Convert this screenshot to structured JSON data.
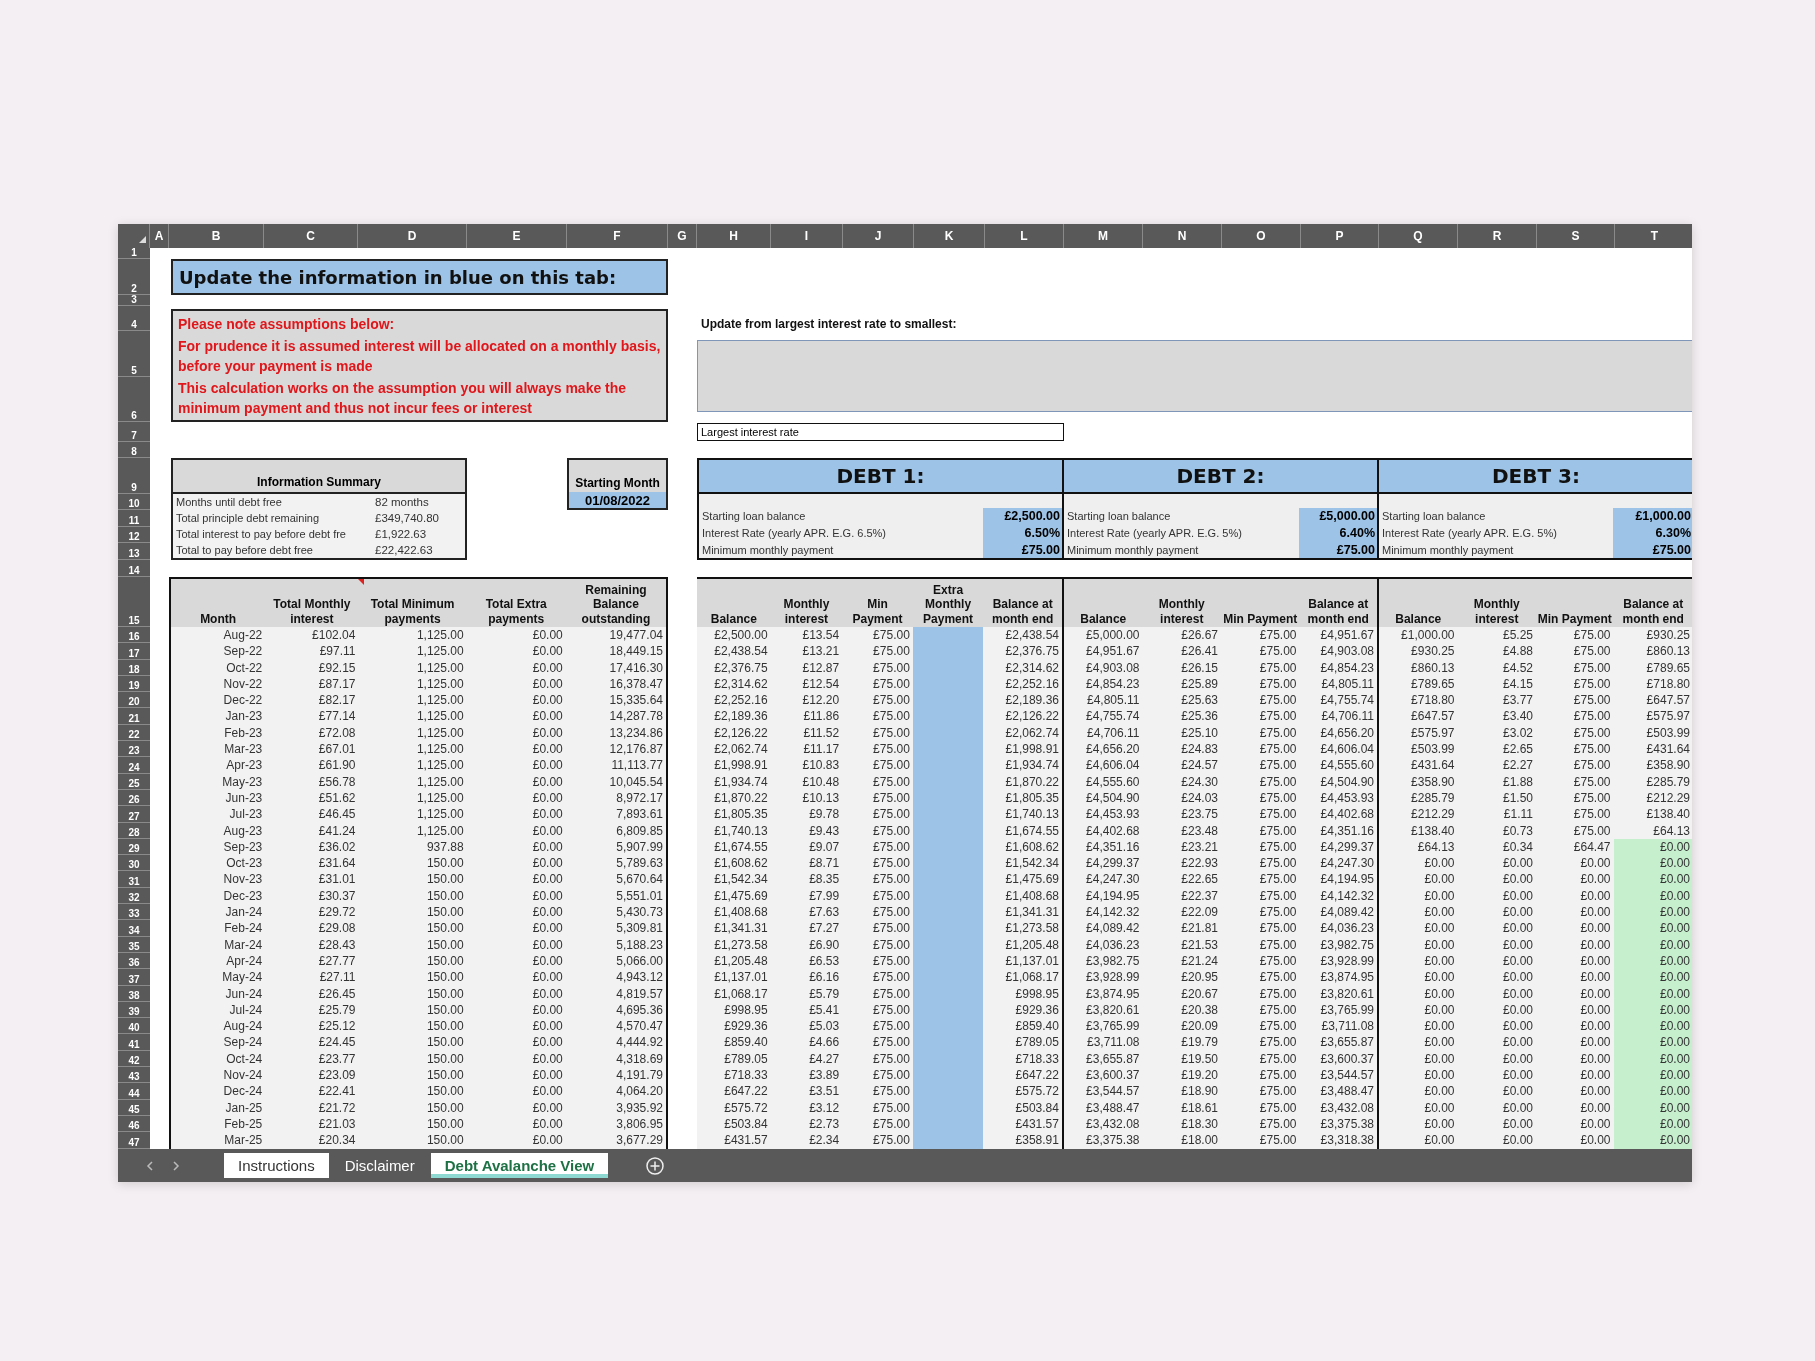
{
  "column_letters": [
    "A",
    "B",
    "C",
    "D",
    "E",
    "F",
    "G",
    "H",
    "I",
    "J",
    "K",
    "L",
    "M",
    "N",
    "O",
    "P",
    "Q",
    "R",
    "S",
    "T"
  ],
  "row_numbers": [
    "1",
    "2",
    "3",
    "4",
    "5",
    "6",
    "7",
    "8",
    "9",
    "10",
    "11",
    "12",
    "13",
    "14",
    "15",
    "16",
    "17",
    "18",
    "19",
    "20",
    "21",
    "22",
    "23",
    "24",
    "25",
    "26",
    "27",
    "28",
    "29",
    "30",
    "31",
    "32",
    "33",
    "34",
    "35",
    "36",
    "37",
    "38",
    "39",
    "40",
    "41",
    "42",
    "43",
    "44",
    "45",
    "46",
    "47"
  ],
  "title": "Update the information in blue on this tab:",
  "assumptions": {
    "heading": "Please note assumptions below:",
    "notes": [
      "For prudence it is assumed interest will be allocated on a monthly basis, before your payment is made",
      "This calculation works on the assumption you will always make the minimum payment and thus not incur fees or interest"
    ]
  },
  "summary": {
    "title": "Information Summary",
    "items": [
      {
        "label": "Months until debt free",
        "value": "82 months"
      },
      {
        "label": "Total principle debt remaining",
        "value": "£349,740.80"
      },
      {
        "label": "Total interest to pay before debt fre",
        "value": "£1,922.63"
      },
      {
        "label": "Total to pay before debt free",
        "value": "£22,422.63"
      }
    ]
  },
  "starting_month": {
    "label": "Starting Month",
    "value": "01/08/2022"
  },
  "debt_order": {
    "instruction": "Update from largest interest rate to smallest:",
    "first_slot": "Largest interest rate"
  },
  "schedule": {
    "columns": [
      "Month",
      "Total Monthly interest",
      "Total Minimum payments",
      "Total Extra payments",
      "Remaining Balance outstanding"
    ],
    "rows": [
      [
        "Aug-22",
        "£102.04",
        "1,125.00",
        "£0.00",
        "19,477.04"
      ],
      [
        "Sep-22",
        "£97.11",
        "1,125.00",
        "£0.00",
        "18,449.15"
      ],
      [
        "Oct-22",
        "£92.15",
        "1,125.00",
        "£0.00",
        "17,416.30"
      ],
      [
        "Nov-22",
        "£87.17",
        "1,125.00",
        "£0.00",
        "16,378.47"
      ],
      [
        "Dec-22",
        "£82.17",
        "1,125.00",
        "£0.00",
        "15,335.64"
      ],
      [
        "Jan-23",
        "£77.14",
        "1,125.00",
        "£0.00",
        "14,287.78"
      ],
      [
        "Feb-23",
        "£72.08",
        "1,125.00",
        "£0.00",
        "13,234.86"
      ],
      [
        "Mar-23",
        "£67.01",
        "1,125.00",
        "£0.00",
        "12,176.87"
      ],
      [
        "Apr-23",
        "£61.90",
        "1,125.00",
        "£0.00",
        "11,113.77"
      ],
      [
        "May-23",
        "£56.78",
        "1,125.00",
        "£0.00",
        "10,045.54"
      ],
      [
        "Jun-23",
        "£51.62",
        "1,125.00",
        "£0.00",
        "8,972.17"
      ],
      [
        "Jul-23",
        "£46.45",
        "1,125.00",
        "£0.00",
        "7,893.61"
      ],
      [
        "Aug-23",
        "£41.24",
        "1,125.00",
        "£0.00",
        "6,809.85"
      ],
      [
        "Sep-23",
        "£36.02",
        "937.88",
        "£0.00",
        "5,907.99"
      ],
      [
        "Oct-23",
        "£31.64",
        "150.00",
        "£0.00",
        "5,789.63"
      ],
      [
        "Nov-23",
        "£31.01",
        "150.00",
        "£0.00",
        "5,670.64"
      ],
      [
        "Dec-23",
        "£30.37",
        "150.00",
        "£0.00",
        "5,551.01"
      ],
      [
        "Jan-24",
        "£29.72",
        "150.00",
        "£0.00",
        "5,430.73"
      ],
      [
        "Feb-24",
        "£29.08",
        "150.00",
        "£0.00",
        "5,309.81"
      ],
      [
        "Mar-24",
        "£28.43",
        "150.00",
        "£0.00",
        "5,188.23"
      ],
      [
        "Apr-24",
        "£27.77",
        "150.00",
        "£0.00",
        "5,066.00"
      ],
      [
        "May-24",
        "£27.11",
        "150.00",
        "£0.00",
        "4,943.12"
      ],
      [
        "Jun-24",
        "£26.45",
        "150.00",
        "£0.00",
        "4,819.57"
      ],
      [
        "Jul-24",
        "£25.79",
        "150.00",
        "£0.00",
        "4,695.36"
      ],
      [
        "Aug-24",
        "£25.12",
        "150.00",
        "£0.00",
        "4,570.47"
      ],
      [
        "Sep-24",
        "£24.45",
        "150.00",
        "£0.00",
        "4,444.92"
      ],
      [
        "Oct-24",
        "£23.77",
        "150.00",
        "£0.00",
        "4,318.69"
      ],
      [
        "Nov-24",
        "£23.09",
        "150.00",
        "£0.00",
        "4,191.79"
      ],
      [
        "Dec-24",
        "£22.41",
        "150.00",
        "£0.00",
        "4,064.20"
      ],
      [
        "Jan-25",
        "£21.72",
        "150.00",
        "£0.00",
        "3,935.92"
      ],
      [
        "Feb-25",
        "£21.03",
        "150.00",
        "£0.00",
        "3,806.95"
      ],
      [
        "Mar-25",
        "£20.34",
        "150.00",
        "£0.00",
        "3,677.29"
      ]
    ]
  },
  "debts": [
    {
      "title": "DEBT 1:",
      "fields": [
        {
          "label": "Starting loan balance",
          "value": "£2,500.00"
        },
        {
          "label": "Interest Rate (yearly APR. E.G. 6.5%)",
          "value": "6.50%"
        },
        {
          "label": "Minimum monthly payment",
          "value": "£75.00"
        }
      ],
      "columns": [
        {
          "label": "Balance",
          "kind": "value"
        },
        {
          "label": "Monthly interest",
          "kind": "value"
        },
        {
          "label": "Min Payment",
          "kind": "value"
        },
        {
          "label": "Extra Monthly Payment",
          "kind": "input"
        },
        {
          "label": "Balance at month end",
          "kind": "value"
        }
      ],
      "rows": [
        {
          "cells": [
            "£2,500.00",
            "£13.54",
            "£75.00",
            "£2,438.54"
          ],
          "cleared": false
        },
        {
          "cells": [
            "£2,438.54",
            "£13.21",
            "£75.00",
            "£2,376.75"
          ],
          "cleared": false
        },
        {
          "cells": [
            "£2,376.75",
            "£12.87",
            "£75.00",
            "£2,314.62"
          ],
          "cleared": false
        },
        {
          "cells": [
            "£2,314.62",
            "£12.54",
            "£75.00",
            "£2,252.16"
          ],
          "cleared": false
        },
        {
          "cells": [
            "£2,252.16",
            "£12.20",
            "£75.00",
            "£2,189.36"
          ],
          "cleared": false
        },
        {
          "cells": [
            "£2,189.36",
            "£11.86",
            "£75.00",
            "£2,126.22"
          ],
          "cleared": false
        },
        {
          "cells": [
            "£2,126.22",
            "£11.52",
            "£75.00",
            "£2,062.74"
          ],
          "cleared": false
        },
        {
          "cells": [
            "£2,062.74",
            "£11.17",
            "£75.00",
            "£1,998.91"
          ],
          "cleared": false
        },
        {
          "cells": [
            "£1,998.91",
            "£10.83",
            "£75.00",
            "£1,934.74"
          ],
          "cleared": false
        },
        {
          "cells": [
            "£1,934.74",
            "£10.48",
            "£75.00",
            "£1,870.22"
          ],
          "cleared": false
        },
        {
          "cells": [
            "£1,870.22",
            "£10.13",
            "£75.00",
            "£1,805.35"
          ],
          "cleared": false
        },
        {
          "cells": [
            "£1,805.35",
            "£9.78",
            "£75.00",
            "£1,740.13"
          ],
          "cleared": false
        },
        {
          "cells": [
            "£1,740.13",
            "£9.43",
            "£75.00",
            "£1,674.55"
          ],
          "cleared": false
        },
        {
          "cells": [
            "£1,674.55",
            "£9.07",
            "£75.00",
            "£1,608.62"
          ],
          "cleared": false
        },
        {
          "cells": [
            "£1,608.62",
            "£8.71",
            "£75.00",
            "£1,542.34"
          ],
          "cleared": false
        },
        {
          "cells": [
            "£1,542.34",
            "£8.35",
            "£75.00",
            "£1,475.69"
          ],
          "cleared": false
        },
        {
          "cells": [
            "£1,475.69",
            "£7.99",
            "£75.00",
            "£1,408.68"
          ],
          "cleared": false
        },
        {
          "cells": [
            "£1,408.68",
            "£7.63",
            "£75.00",
            "£1,341.31"
          ],
          "cleared": false
        },
        {
          "cells": [
            "£1,341.31",
            "£7.27",
            "£75.00",
            "£1,273.58"
          ],
          "cleared": false
        },
        {
          "cells": [
            "£1,273.58",
            "£6.90",
            "£75.00",
            "£1,205.48"
          ],
          "cleared": false
        },
        {
          "cells": [
            "£1,205.48",
            "£6.53",
            "£75.00",
            "£1,137.01"
          ],
          "cleared": false
        },
        {
          "cells": [
            "£1,137.01",
            "£6.16",
            "£75.00",
            "£1,068.17"
          ],
          "cleared": false
        },
        {
          "cells": [
            "£1,068.17",
            "£5.79",
            "£75.00",
            "£998.95"
          ],
          "cleared": false
        },
        {
          "cells": [
            "£998.95",
            "£5.41",
            "£75.00",
            "£929.36"
          ],
          "cleared": false
        },
        {
          "cells": [
            "£929.36",
            "£5.03",
            "£75.00",
            "£859.40"
          ],
          "cleared": false
        },
        {
          "cells": [
            "£859.40",
            "£4.66",
            "£75.00",
            "£789.05"
          ],
          "cleared": false
        },
        {
          "cells": [
            "£789.05",
            "£4.27",
            "£75.00",
            "£718.33"
          ],
          "cleared": false
        },
        {
          "cells": [
            "£718.33",
            "£3.89",
            "£75.00",
            "£647.22"
          ],
          "cleared": false
        },
        {
          "cells": [
            "£647.22",
            "£3.51",
            "£75.00",
            "£575.72"
          ],
          "cleared": false
        },
        {
          "cells": [
            "£575.72",
            "£3.12",
            "£75.00",
            "£503.84"
          ],
          "cleared": false
        },
        {
          "cells": [
            "£503.84",
            "£2.73",
            "£75.00",
            "£431.57"
          ],
          "cleared": false
        },
        {
          "cells": [
            "£431.57",
            "£2.34",
            "£75.00",
            "£358.91"
          ],
          "cleared": false
        }
      ]
    },
    {
      "title": "DEBT 2:",
      "fields": [
        {
          "label": "Starting loan balance",
          "value": "£5,000.00"
        },
        {
          "label": "Interest Rate (yearly APR. E.G. 5%)",
          "value": "6.40%"
        },
        {
          "label": "Minimum monthly payment",
          "value": "£75.00"
        }
      ],
      "columns": [
        {
          "label": "Balance",
          "kind": "value"
        },
        {
          "label": "Monthly interest",
          "kind": "value"
        },
        {
          "label": "Min Payment",
          "kind": "value"
        },
        {
          "label": "Balance at month end",
          "kind": "value"
        }
      ],
      "rows": [
        {
          "cells": [
            "£5,000.00",
            "£26.67",
            "£75.00",
            "£4,951.67"
          ],
          "cleared": false
        },
        {
          "cells": [
            "£4,951.67",
            "£26.41",
            "£75.00",
            "£4,903.08"
          ],
          "cleared": false
        },
        {
          "cells": [
            "£4,903.08",
            "£26.15",
            "£75.00",
            "£4,854.23"
          ],
          "cleared": false
        },
        {
          "cells": [
            "£4,854.23",
            "£25.89",
            "£75.00",
            "£4,805.11"
          ],
          "cleared": false
        },
        {
          "cells": [
            "£4,805.11",
            "£25.63",
            "£75.00",
            "£4,755.74"
          ],
          "cleared": false
        },
        {
          "cells": [
            "£4,755.74",
            "£25.36",
            "£75.00",
            "£4,706.11"
          ],
          "cleared": false
        },
        {
          "cells": [
            "£4,706.11",
            "£25.10",
            "£75.00",
            "£4,656.20"
          ],
          "cleared": false
        },
        {
          "cells": [
            "£4,656.20",
            "£24.83",
            "£75.00",
            "£4,606.04"
          ],
          "cleared": false
        },
        {
          "cells": [
            "£4,606.04",
            "£24.57",
            "£75.00",
            "£4,555.60"
          ],
          "cleared": false
        },
        {
          "cells": [
            "£4,555.60",
            "£24.30",
            "£75.00",
            "£4,504.90"
          ],
          "cleared": false
        },
        {
          "cells": [
            "£4,504.90",
            "£24.03",
            "£75.00",
            "£4,453.93"
          ],
          "cleared": false
        },
        {
          "cells": [
            "£4,453.93",
            "£23.75",
            "£75.00",
            "£4,402.68"
          ],
          "cleared": false
        },
        {
          "cells": [
            "£4,402.68",
            "£23.48",
            "£75.00",
            "£4,351.16"
          ],
          "cleared": false
        },
        {
          "cells": [
            "£4,351.16",
            "£23.21",
            "£75.00",
            "£4,299.37"
          ],
          "cleared": false
        },
        {
          "cells": [
            "£4,299.37",
            "£22.93",
            "£75.00",
            "£4,247.30"
          ],
          "cleared": false
        },
        {
          "cells": [
            "£4,247.30",
            "£22.65",
            "£75.00",
            "£4,194.95"
          ],
          "cleared": false
        },
        {
          "cells": [
            "£4,194.95",
            "£22.37",
            "£75.00",
            "£4,142.32"
          ],
          "cleared": false
        },
        {
          "cells": [
            "£4,142.32",
            "£22.09",
            "£75.00",
            "£4,089.42"
          ],
          "cleared": false
        },
        {
          "cells": [
            "£4,089.42",
            "£21.81",
            "£75.00",
            "£4,036.23"
          ],
          "cleared": false
        },
        {
          "cells": [
            "£4,036.23",
            "£21.53",
            "£75.00",
            "£3,982.75"
          ],
          "cleared": false
        },
        {
          "cells": [
            "£3,982.75",
            "£21.24",
            "£75.00",
            "£3,928.99"
          ],
          "cleared": false
        },
        {
          "cells": [
            "£3,928.99",
            "£20.95",
            "£75.00",
            "£3,874.95"
          ],
          "cleared": false
        },
        {
          "cells": [
            "£3,874.95",
            "£20.67",
            "£75.00",
            "£3,820.61"
          ],
          "cleared": false
        },
        {
          "cells": [
            "£3,820.61",
            "£20.38",
            "£75.00",
            "£3,765.99"
          ],
          "cleared": false
        },
        {
          "cells": [
            "£3,765.99",
            "£20.09",
            "£75.00",
            "£3,711.08"
          ],
          "cleared": false
        },
        {
          "cells": [
            "£3,711.08",
            "£19.79",
            "£75.00",
            "£3,655.87"
          ],
          "cleared": false
        },
        {
          "cells": [
            "£3,655.87",
            "£19.50",
            "£75.00",
            "£3,600.37"
          ],
          "cleared": false
        },
        {
          "cells": [
            "£3,600.37",
            "£19.20",
            "£75.00",
            "£3,544.57"
          ],
          "cleared": false
        },
        {
          "cells": [
            "£3,544.57",
            "£18.90",
            "£75.00",
            "£3,488.47"
          ],
          "cleared": false
        },
        {
          "cells": [
            "£3,488.47",
            "£18.61",
            "£75.00",
            "£3,432.08"
          ],
          "cleared": false
        },
        {
          "cells": [
            "£3,432.08",
            "£18.30",
            "£75.00",
            "£3,375.38"
          ],
          "cleared": false
        },
        {
          "cells": [
            "£3,375.38",
            "£18.00",
            "£75.00",
            "£3,318.38"
          ],
          "cleared": false
        }
      ]
    },
    {
      "title": "DEBT 3:",
      "fields": [
        {
          "label": "Starting loan balance",
          "value": "£1,000.00"
        },
        {
          "label": "Interest Rate (yearly APR. E.G. 5%)",
          "value": "6.30%"
        },
        {
          "label": "Minimum monthly payment",
          "value": "£75.00"
        }
      ],
      "columns": [
        {
          "label": "Balance",
          "kind": "value"
        },
        {
          "label": "Monthly interest",
          "kind": "value"
        },
        {
          "label": "Min Payment",
          "kind": "value"
        },
        {
          "label": "Balance at month end",
          "kind": "value"
        }
      ],
      "rows": [
        {
          "cells": [
            "£1,000.00",
            "£5.25",
            "£75.00",
            "£930.25"
          ],
          "cleared": false
        },
        {
          "cells": [
            "£930.25",
            "£4.88",
            "£75.00",
            "£860.13"
          ],
          "cleared": false
        },
        {
          "cells": [
            "£860.13",
            "£4.52",
            "£75.00",
            "£789.65"
          ],
          "cleared": false
        },
        {
          "cells": [
            "£789.65",
            "£4.15",
            "£75.00",
            "£718.80"
          ],
          "cleared": false
        },
        {
          "cells": [
            "£718.80",
            "£3.77",
            "£75.00",
            "£647.57"
          ],
          "cleared": false
        },
        {
          "cells": [
            "£647.57",
            "£3.40",
            "£75.00",
            "£575.97"
          ],
          "cleared": false
        },
        {
          "cells": [
            "£575.97",
            "£3.02",
            "£75.00",
            "£503.99"
          ],
          "cleared": false
        },
        {
          "cells": [
            "£503.99",
            "£2.65",
            "£75.00",
            "£431.64"
          ],
          "cleared": false
        },
        {
          "cells": [
            "£431.64",
            "£2.27",
            "£75.00",
            "£358.90"
          ],
          "cleared": false
        },
        {
          "cells": [
            "£358.90",
            "£1.88",
            "£75.00",
            "£285.79"
          ],
          "cleared": false
        },
        {
          "cells": [
            "£285.79",
            "£1.50",
            "£75.00",
            "£212.29"
          ],
          "cleared": false
        },
        {
          "cells": [
            "£212.29",
            "£1.11",
            "£75.00",
            "£138.40"
          ],
          "cleared": false
        },
        {
          "cells": [
            "£138.40",
            "£0.73",
            "£75.00",
            "£64.13"
          ],
          "cleared": false
        },
        {
          "cells": [
            "£64.13",
            "£0.34",
            "£64.47",
            "£0.00"
          ],
          "cleared": true
        },
        {
          "cells": [
            "£0.00",
            "£0.00",
            "£0.00",
            "£0.00"
          ],
          "cleared": true
        },
        {
          "cells": [
            "£0.00",
            "£0.00",
            "£0.00",
            "£0.00"
          ],
          "cleared": true
        },
        {
          "cells": [
            "£0.00",
            "£0.00",
            "£0.00",
            "£0.00"
          ],
          "cleared": true
        },
        {
          "cells": [
            "£0.00",
            "£0.00",
            "£0.00",
            "£0.00"
          ],
          "cleared": true
        },
        {
          "cells": [
            "£0.00",
            "£0.00",
            "£0.00",
            "£0.00"
          ],
          "cleared": true
        },
        {
          "cells": [
            "£0.00",
            "£0.00",
            "£0.00",
            "£0.00"
          ],
          "cleared": true
        },
        {
          "cells": [
            "£0.00",
            "£0.00",
            "£0.00",
            "£0.00"
          ],
          "cleared": true
        },
        {
          "cells": [
            "£0.00",
            "£0.00",
            "£0.00",
            "£0.00"
          ],
          "cleared": true
        },
        {
          "cells": [
            "£0.00",
            "£0.00",
            "£0.00",
            "£0.00"
          ],
          "cleared": true
        },
        {
          "cells": [
            "£0.00",
            "£0.00",
            "£0.00",
            "£0.00"
          ],
          "cleared": true
        },
        {
          "cells": [
            "£0.00",
            "£0.00",
            "£0.00",
            "£0.00"
          ],
          "cleared": true
        },
        {
          "cells": [
            "£0.00",
            "£0.00",
            "£0.00",
            "£0.00"
          ],
          "cleared": true
        },
        {
          "cells": [
            "£0.00",
            "£0.00",
            "£0.00",
            "£0.00"
          ],
          "cleared": true
        },
        {
          "cells": [
            "£0.00",
            "£0.00",
            "£0.00",
            "£0.00"
          ],
          "cleared": true
        },
        {
          "cells": [
            "£0.00",
            "£0.00",
            "£0.00",
            "£0.00"
          ],
          "cleared": true
        },
        {
          "cells": [
            "£0.00",
            "£0.00",
            "£0.00",
            "£0.00"
          ],
          "cleared": true
        },
        {
          "cells": [
            "£0.00",
            "£0.00",
            "£0.00",
            "£0.00"
          ],
          "cleared": true
        },
        {
          "cells": [
            "£0.00",
            "£0.00",
            "£0.00",
            "£0.00"
          ],
          "cleared": true
        }
      ]
    }
  ],
  "sheet_tabs": [
    {
      "label": "Instructions",
      "selected": false,
      "hovered": true
    },
    {
      "label": "Disclaimer",
      "selected": false,
      "hovered": false
    },
    {
      "label": "Debt Avalanche View",
      "selected": true,
      "hovered": false
    }
  ]
}
